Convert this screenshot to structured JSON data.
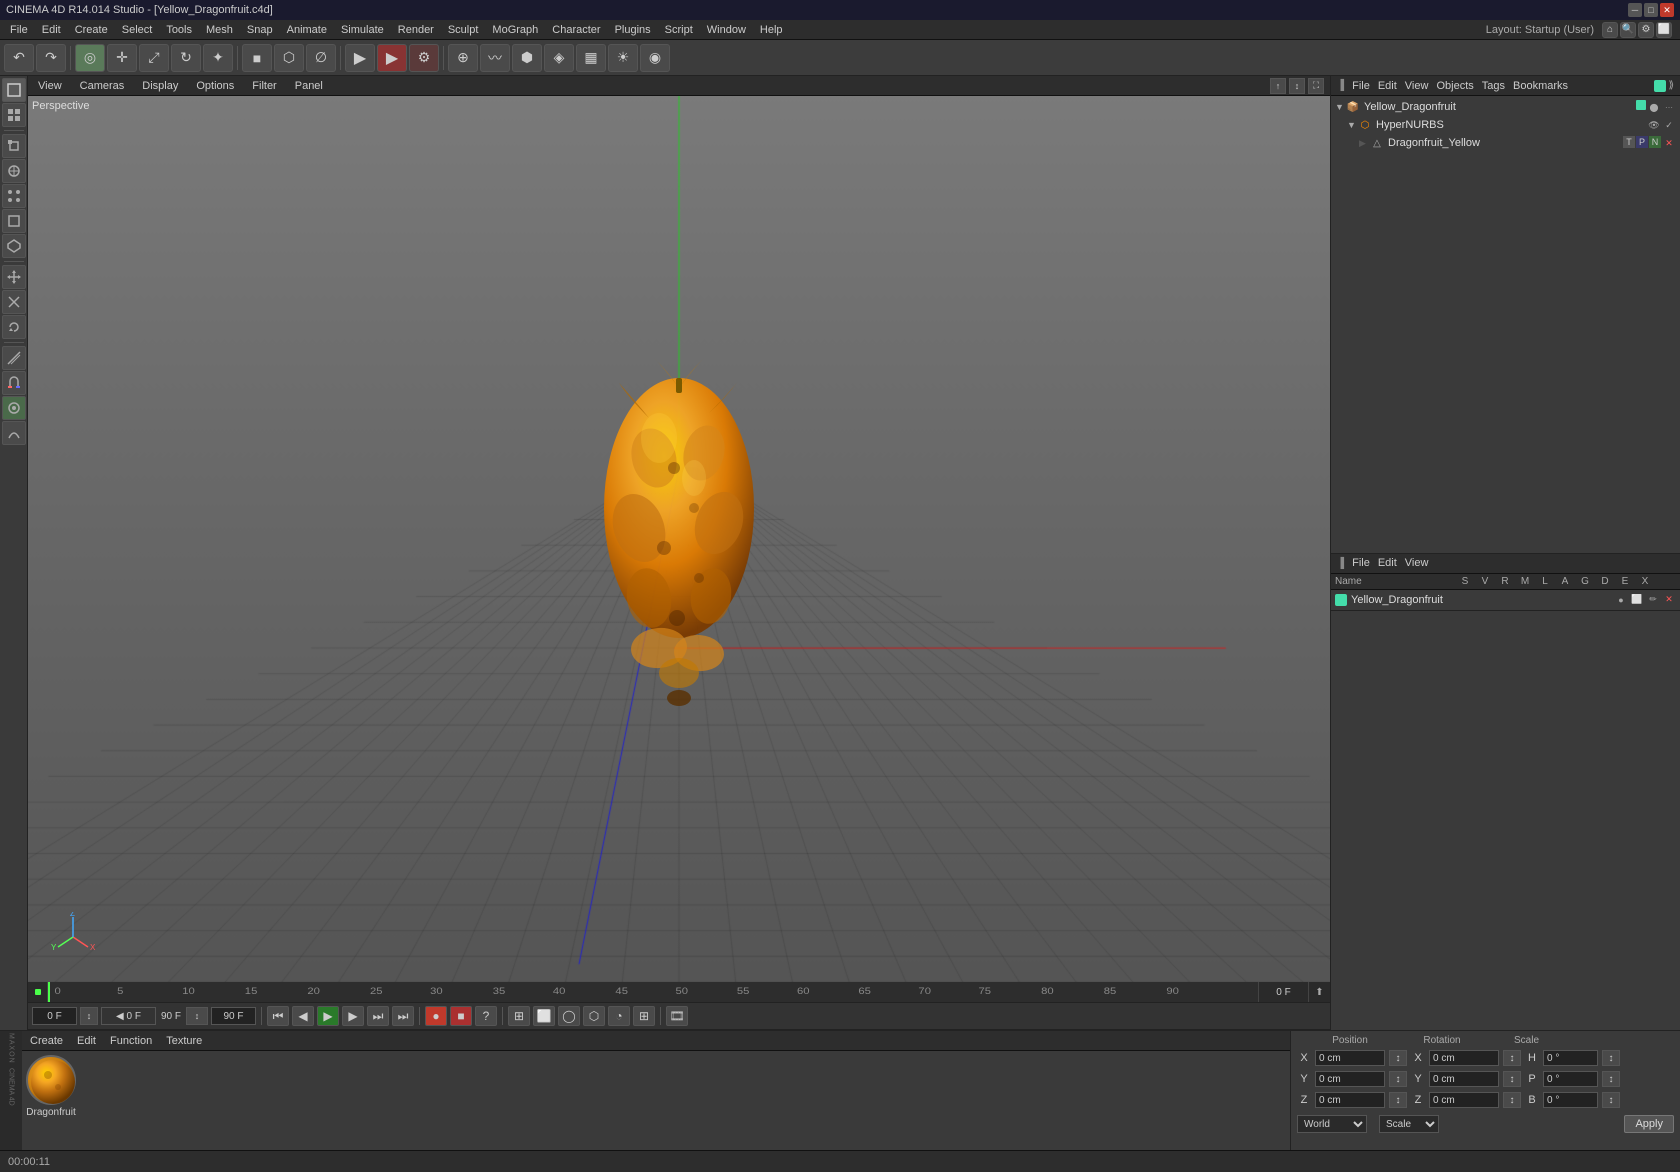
{
  "titleBar": {
    "title": "CINEMA 4D R14.014 Studio - [Yellow_Dragonfruit.c4d]",
    "minBtn": "─",
    "maxBtn": "□",
    "closeBtn": "✕"
  },
  "menuBar": {
    "items": [
      "File",
      "Edit",
      "Create",
      "Select",
      "Tools",
      "Mesh",
      "Snap",
      "Animate",
      "Simulate",
      "Render",
      "Sculpt",
      "MoGraph",
      "Character",
      "Plugins",
      "Script",
      "Window",
      "Help"
    ]
  },
  "viewport": {
    "label": "Perspective",
    "menus": [
      "View",
      "Cameras",
      "Display",
      "Options",
      "Filter",
      "Panel"
    ]
  },
  "rightPanel": {
    "topHeader": {
      "menus": [
        "File",
        "Edit",
        "View",
        "Objects",
        "Tags",
        "Bookmarks"
      ]
    },
    "objects": [
      {
        "name": "Yellow_Dragonfruit",
        "level": 0,
        "icon": "📦",
        "color": "#4da"
      },
      {
        "name": "HyperNURBS",
        "level": 1,
        "icon": "⬡",
        "color": "#ff8c00"
      },
      {
        "name": "Dragonfruit_Yellow",
        "level": 2,
        "icon": "△",
        "color": "#aaa"
      }
    ],
    "bottomHeader": {
      "menus": [
        "File",
        "Edit",
        "View"
      ]
    },
    "attrColumns": [
      "Name",
      "S",
      "V",
      "R",
      "M",
      "L",
      "A",
      "G",
      "D",
      "E",
      "X"
    ],
    "material": {
      "name": "Yellow_Dragonfruit",
      "color": "#4da"
    }
  },
  "timeline": {
    "markers": [
      "0",
      "5",
      "10",
      "15",
      "20",
      "25",
      "30",
      "35",
      "40",
      "45",
      "50",
      "55",
      "60",
      "65",
      "70",
      "75",
      "80",
      "85",
      "90"
    ],
    "currentFrame": "0 F",
    "startFrame": "0 F",
    "endFrame": "90 F",
    "currentTime": "90 F"
  },
  "playback": {
    "frame": "0 F",
    "frameInput": "0 F",
    "endFrame": "90 F",
    "endInput": "90 F"
  },
  "materialBar": {
    "menus": [
      "Create",
      "Edit",
      "Function",
      "Texture"
    ],
    "material": {
      "name": "Dragonfruit",
      "thumbnail": "dragon_fruit"
    }
  },
  "coordinates": {
    "x": {
      "pos": "0 cm",
      "rot": "0 cm",
      "angle": "0 °"
    },
    "y": {
      "pos": "0 cm",
      "rot": "0 cm",
      "angle": "0 °"
    },
    "z": {
      "pos": "0 cm",
      "rot": "0 cm",
      "angle": "0 °"
    },
    "space": "World",
    "mode": "Scale",
    "applyBtn": "Apply"
  },
  "statusBar": {
    "time": "00:00:11",
    "logo": "MAXON\nCINEMA 4D"
  }
}
